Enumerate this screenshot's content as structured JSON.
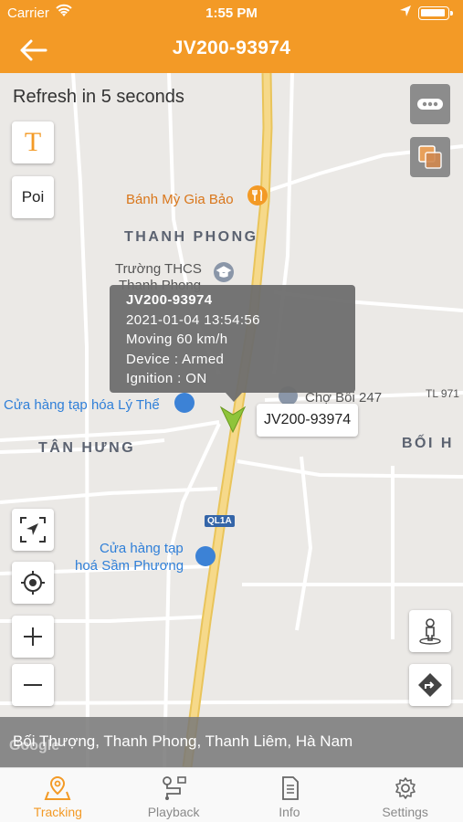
{
  "status_bar": {
    "carrier": "Carrier",
    "time": "1:55 PM"
  },
  "header": {
    "title": "JV200-93974",
    "back_icon": "arrow-left-icon"
  },
  "map": {
    "refresh_text": "Refresh in 5 seconds",
    "left_controls": {
      "text_toggle": "T",
      "poi": "Poi"
    },
    "places": {
      "banh_my": "Bánh Mỳ Gia Bảo",
      "thanh_phong": "THANH PHONG",
      "truong_line1": "Trường THCS",
      "truong_line2": "Thanh Phong",
      "cho_boi": "Chợ Bối 247",
      "tl_road": "TL 971",
      "cua_hang_ly": "Cửa hàng tạp hóa Lý Thể",
      "tan_hung": "TÂN HƯNG",
      "boi_h": "BỐI H",
      "ql1a": "QL1A",
      "sam_phuong_line1": "Cửa hàng tạp",
      "sam_phuong_line2": "hoá Sầm Phương"
    },
    "popup": {
      "name": "JV200-93974",
      "datetime": "2021-01-04 13:54:56",
      "status": "Moving 60 km/h",
      "device": "Device : Armed",
      "ignition": "Ignition : ON"
    },
    "vehicle_label": "JV200-93974",
    "address": "Bối Thượng, Thanh Phong, Thanh Liêm, Hà Nam",
    "attribution": "Google",
    "colors": {
      "accent": "#f39a26",
      "road_main": "#f5d36e",
      "vehicle": "#8fc43a"
    }
  },
  "tabbar": {
    "items": [
      {
        "label": "Tracking",
        "icon": "map-pin-icon",
        "active": true
      },
      {
        "label": "Playback",
        "icon": "playback-route-icon",
        "active": false
      },
      {
        "label": "Info",
        "icon": "document-icon",
        "active": false
      },
      {
        "label": "Settings",
        "icon": "gear-icon",
        "active": false
      }
    ]
  }
}
